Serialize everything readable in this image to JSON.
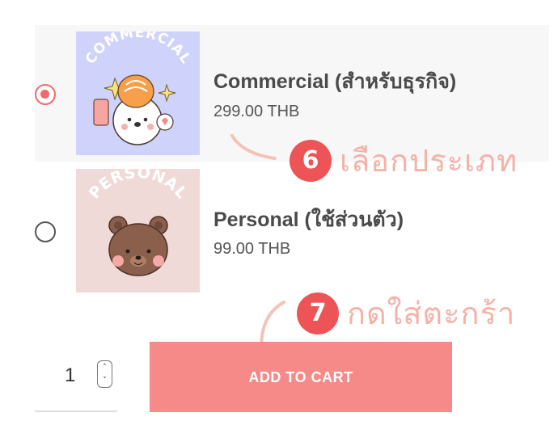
{
  "options": [
    {
      "name": "Commercial (สำหรับธุรกิจ)",
      "price": "299.00 THB",
      "selected": true,
      "thumbnail_text": "COMMERCIAL",
      "thumbnail_bg": "#cfd3fb"
    },
    {
      "name": "Personal (ใช้ส่วนตัว)",
      "price": "99.00 THB",
      "selected": false,
      "thumbnail_text": "PERSONAL",
      "thumbnail_bg": "#f0dad7"
    }
  ],
  "annotations": [
    {
      "number": "6",
      "text": "เลือกประเภท"
    },
    {
      "number": "7",
      "text": "กดใส่ตะกร้า"
    }
  ],
  "quantity": {
    "value": "1"
  },
  "cart": {
    "add_label": "ADD TO CART"
  },
  "colors": {
    "accent": "#ec5457",
    "button": "#f58a88",
    "annotation_text": "#f4b2a7"
  }
}
